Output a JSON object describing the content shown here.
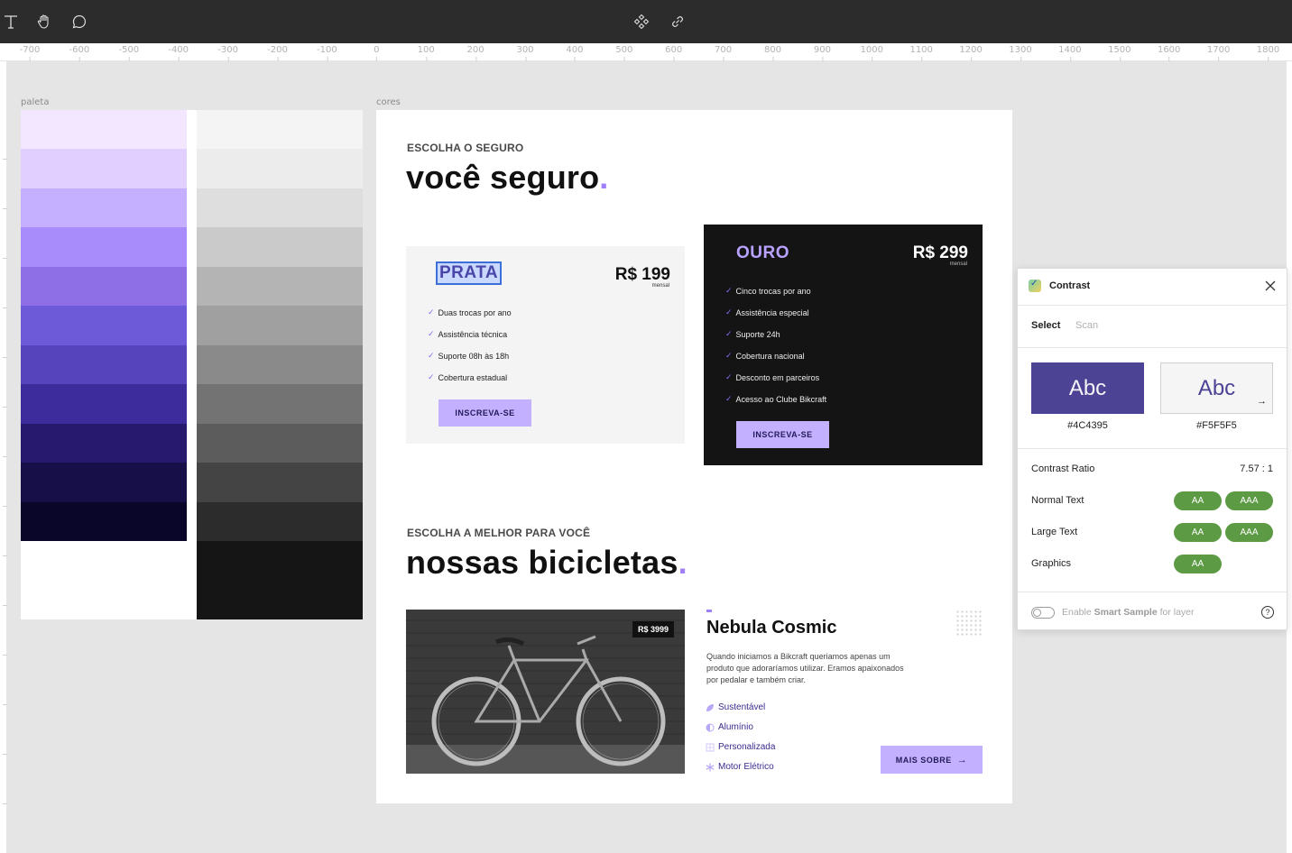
{
  "toolbar": {
    "left_tools": [
      "text-icon",
      "hand-icon",
      "comment-icon"
    ],
    "center_tools": [
      "component-icon",
      "link-icon"
    ]
  },
  "ruler": {
    "ticks": [
      "-700",
      "-600",
      "-500",
      "-400",
      "-300",
      "-200",
      "-100",
      "0",
      "100",
      "200",
      "300",
      "400",
      "500",
      "600",
      "700",
      "800",
      "900",
      "1000",
      "1100",
      "1200",
      "1300",
      "1400",
      "1500",
      "1600",
      "1700",
      "1800"
    ]
  },
  "frames": {
    "paleta_label": "paleta",
    "cores_label": "cores"
  },
  "palette": {
    "purples": [
      "#f3e6ff",
      "#e0cfff",
      "#c5b0ff",
      "#a98cfb",
      "#8e6fe6",
      "#6c5ad9",
      "#5644bd",
      "#3c2c9c",
      "#26196e",
      "#170f48",
      "#09062a"
    ],
    "grays": [
      "#f4f4f4",
      "#ececec",
      "#dedede",
      "#cacaca",
      "#b4b4b4",
      "#a0a0a0",
      "#8a8a8a",
      "#737373",
      "#5c5c5c",
      "#444444",
      "#2c2c2c",
      "#151515"
    ]
  },
  "insurance": {
    "eyebrow": "ESCOLHA O SEGURO",
    "title": "você seguro",
    "title_dot": ".",
    "prata": {
      "name": "PRATA",
      "price": "R$ 199",
      "period": "mensal",
      "features": [
        "Duas trocas por ano",
        "Assistência técnica",
        "Suporte 08h às 18h",
        "Cobertura estadual"
      ],
      "button": "INSCREVA-SE"
    },
    "ouro": {
      "name": "OURO",
      "price": "R$ 299",
      "period": "mensal",
      "features": [
        "Cinco trocas por ano",
        "Assistência especial",
        "Suporte 24h",
        "Cobertura nacional",
        "Desconto em parceiros",
        "Acesso ao Clube Bikcraft"
      ],
      "button": "INSCREVA-SE"
    }
  },
  "bikes": {
    "eyebrow": "ESCOLHA A MELHOR PARA VOCÊ",
    "title": "nossas bicicletas",
    "title_dot": ".",
    "price_tag": "R$ 3999",
    "product_name": "Nebula Cosmic",
    "description": "Quando iniciamos a Bikcraft queriamos apenas um produto que adoraríamos utilizar. Eramos apaixonados por pedalar e também criar.",
    "properties": [
      "Sustentável",
      "Alumínio",
      "Personalizada",
      "Motor Elétrico"
    ],
    "button": "MAIS SOBRE"
  },
  "contrast_panel": {
    "title": "Contrast",
    "tab_select": "Select",
    "tab_scan": "Scan",
    "sample_text": "Abc",
    "fg_hex": "#4C4395",
    "bg_hex": "#F5F5F5",
    "ratio_label": "Contrast Ratio",
    "ratio_value": "7.57 : 1",
    "rows": [
      {
        "label": "Normal Text",
        "aa": "AA",
        "aaa": "AAA"
      },
      {
        "label": "Large Text",
        "aa": "AA",
        "aaa": "AAA"
      },
      {
        "label": "Graphics",
        "aa": "AA"
      }
    ],
    "smart_sample_pre": "Enable",
    "smart_sample_bold": "Smart Sample",
    "smart_sample_post": "for layer",
    "colors": {
      "fg": "#4C4395",
      "bg": "#F5F5F5",
      "pass": "#5c9a44"
    }
  }
}
